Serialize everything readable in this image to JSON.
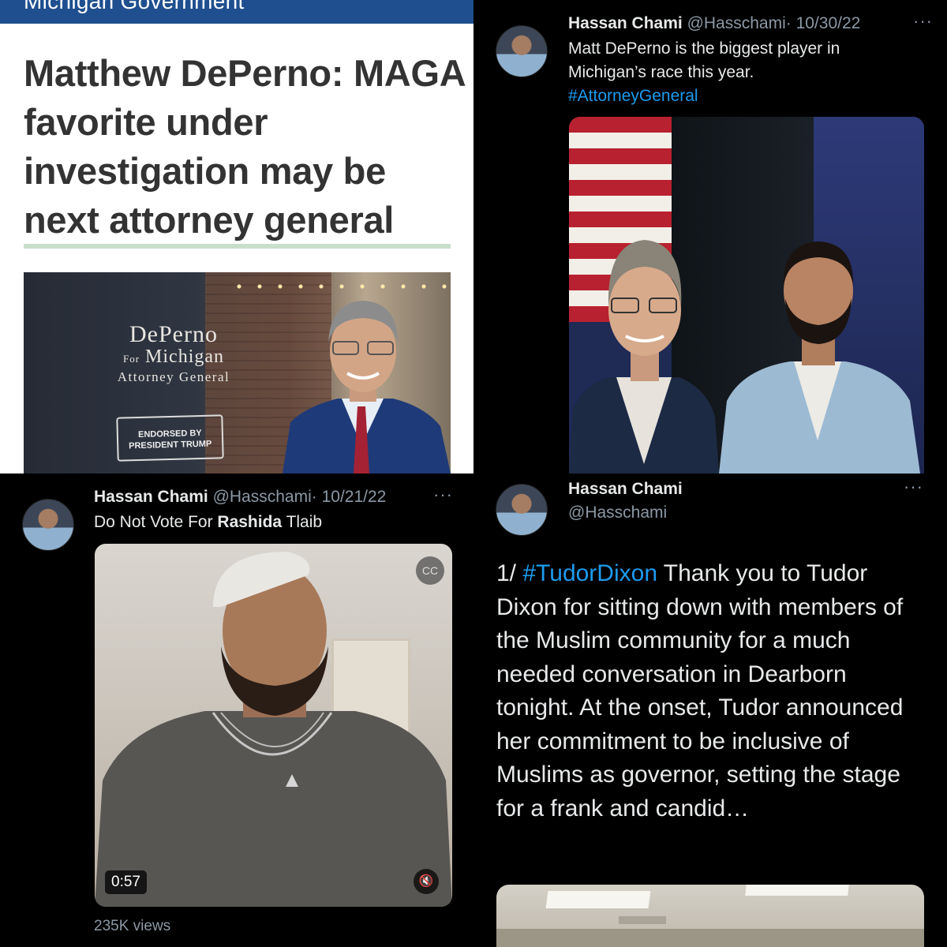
{
  "article": {
    "section": "Michigan Government",
    "headline": "Matthew DePerno: MAGA favorite under investigation may be next attorney general",
    "sign_line1": "DePerno",
    "sign_line2_prefix": "For",
    "sign_line2": "Michigan",
    "sign_line3": "Attorney General",
    "badge_line1": "ENDORSED BY",
    "badge_line2": "PRESIDENT TRUMP"
  },
  "tweet_top": {
    "name": "Hassan Chami",
    "handle": "@Hasschami",
    "date": "· 10/30/22",
    "more": "···",
    "text_line1": "Matt DePerno is the biggest player in",
    "text_line2": "Michigan’s race this year.",
    "hashtag": "#AttorneyGeneral"
  },
  "tweet_video": {
    "name": "Hassan Chami",
    "handle": "@Hasschami",
    "date": "· 10/21/22",
    "more": "···",
    "text_before": "Do Not Vote For ",
    "text_bold": "Rashida",
    "text_after": " Tlaib",
    "duration": "0:57",
    "views": "235K views"
  },
  "tweet_tudor": {
    "name": "Hassan Chami",
    "handle": "@Hasschami",
    "more": "···",
    "prefix": "1/ ",
    "hashtag": "#TudorDixon",
    "text": " Thank you to Tudor Dixon for sitting down with members of the Muslim community for a much needed conversation in Dearborn tonight. At the onset, Tudor announced her commitment to be inclusive of Muslims as governor, setting the stage for a frank and candid…"
  },
  "colors": {
    "link": "#1d9bf0",
    "muted": "#8b98a5",
    "article_bar": "#1f4f8f",
    "headline": "#333333"
  },
  "icons": [
    "more-icon",
    "captions-icon",
    "mute-icon"
  ]
}
